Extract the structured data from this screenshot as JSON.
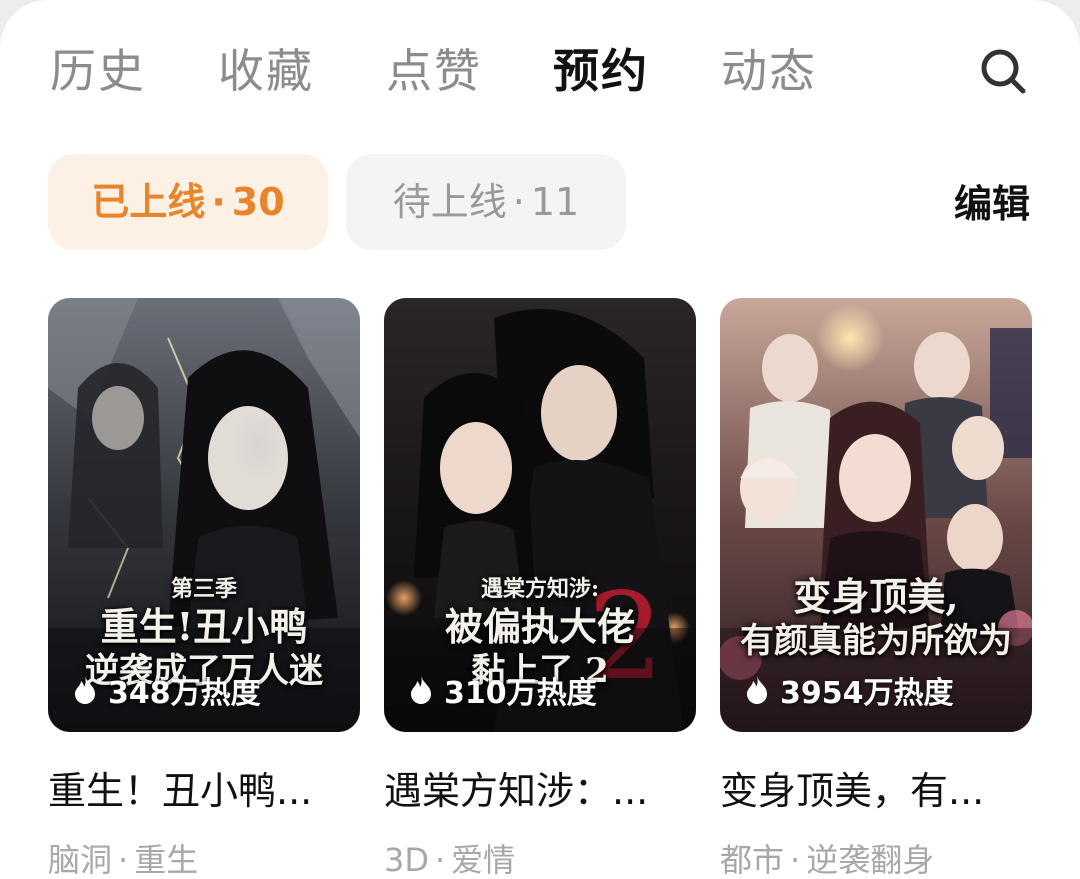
{
  "tabs": [
    {
      "label": "历史"
    },
    {
      "label": "收藏"
    },
    {
      "label": "点赞"
    },
    {
      "label": "预约",
      "active": true
    },
    {
      "label": "动态"
    }
  ],
  "search": {
    "icon": "search-icon"
  },
  "filters": {
    "online": {
      "label": "已上线",
      "sep": "·",
      "count": "30",
      "selected": true
    },
    "pending": {
      "label": "待上线",
      "sep": "·",
      "count": "11"
    },
    "edit_label": "编辑"
  },
  "colors": {
    "accent": "#e8842a",
    "accent_bg": "#fdf0e4",
    "chip_bg": "#f4f4f4",
    "muted": "#a8a8a8"
  },
  "books": [
    {
      "title": "重生！丑小鸭...",
      "tag1": "脑洞",
      "tag_sep": "·",
      "tag2": "重生",
      "heat": "348万热度",
      "cover_line1": "第三季",
      "cover_line2": "重生!丑小鸭",
      "cover_line3": "逆袭成了万人迷"
    },
    {
      "title": "遇棠方知涉：...",
      "tag1": "3D",
      "tag_sep": "·",
      "tag2": "爱情",
      "heat": "310万热度",
      "cover_line1": "遇棠方知涉:",
      "cover_line2": "被偏执大佬",
      "cover_line3": "黏上了 2"
    },
    {
      "title": "变身顶美，有...",
      "tag1": "都市",
      "tag_sep": "·",
      "tag2": "逆袭翻身",
      "heat": "3954万热度",
      "cover_line1": "",
      "cover_line2": "变身顶美,",
      "cover_line3": "有颜真能为所欲为"
    }
  ]
}
